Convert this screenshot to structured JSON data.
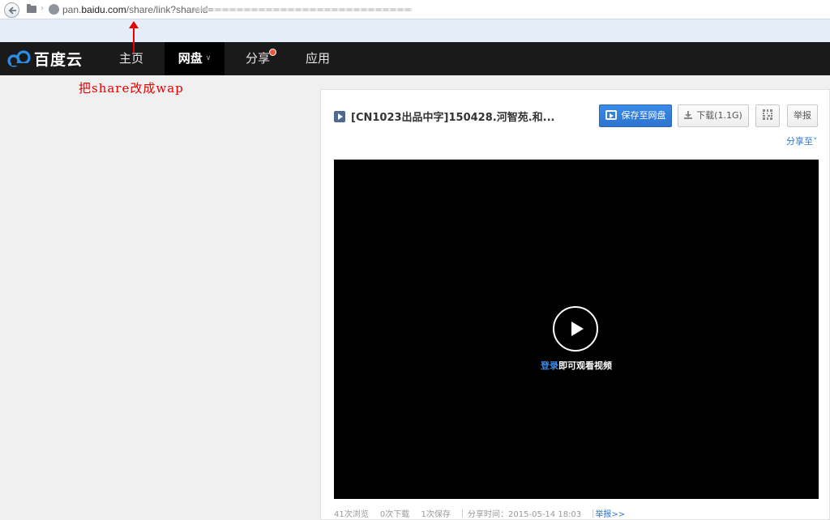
{
  "browser": {
    "url_domain_prefix": "pan.",
    "url_domain": "baidu.com",
    "url_path": "/share/link?shareid="
  },
  "nav": {
    "logo_text": "百度云",
    "items": [
      {
        "label": "主页"
      },
      {
        "label": "网盘"
      },
      {
        "label": "分享"
      },
      {
        "label": "应用"
      }
    ],
    "active": "网盘"
  },
  "annotation": {
    "text": "把share改成wap",
    "color": "#e60000"
  },
  "file": {
    "title": "[CN1023出品中字]150428.河智苑.和...",
    "buttons": {
      "save": "保存至网盘",
      "download": "下载(1.1G)",
      "report": "举报"
    },
    "share_to": "分享至"
  },
  "player": {
    "login_link": "登录",
    "login_rest": "即可观看视频"
  },
  "stats": {
    "views": "41次浏览",
    "downloads": "0次下载",
    "saves": "1次保存",
    "share_time": "分享时间：2015-05-14 18:03",
    "report": "举报>>"
  },
  "colors": {
    "accent": "#2c74cf",
    "nav_bg": "#1a1a1a",
    "badge": "#e53"
  }
}
